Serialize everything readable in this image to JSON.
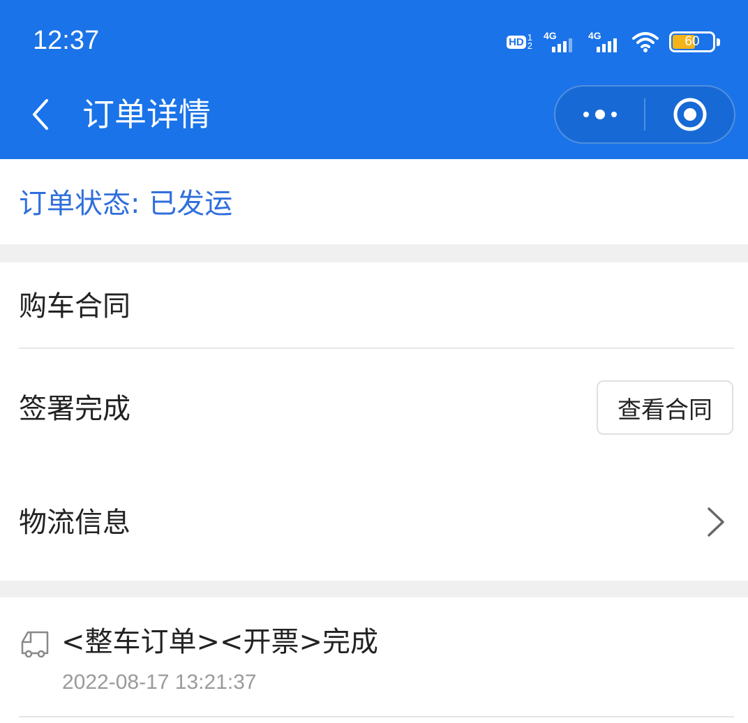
{
  "status_bar": {
    "time": "12:37",
    "hd_label": "HD",
    "sim_sup_top": "1",
    "sim_sup_bottom": "2",
    "signal1_label": "4G",
    "signal2_label": "4G",
    "battery_level": "60",
    "battery_fraction": 0.6,
    "battery_color": "#f2b31b"
  },
  "nav": {
    "title": "订单详情",
    "back_icon": "chevron-left-icon",
    "more_icon": "more-dots-icon",
    "close_icon": "target-circle-icon"
  },
  "order": {
    "status_text": "订单状态: 已发运"
  },
  "contract": {
    "section_title": "购车合同",
    "sign_status": "签署完成",
    "view_button_label": "查看合同"
  },
  "logistics": {
    "label": "物流信息",
    "chevron_icon": "chevron-right-icon"
  },
  "log": {
    "icon": "truck-icon",
    "title": "<整车订单><开票>完成",
    "time": "2022-08-17 13:21:37"
  },
  "colors": {
    "header_bg": "#1a73e8",
    "accent_text": "#2f6fdb",
    "band_gray": "#f0f0f0"
  }
}
